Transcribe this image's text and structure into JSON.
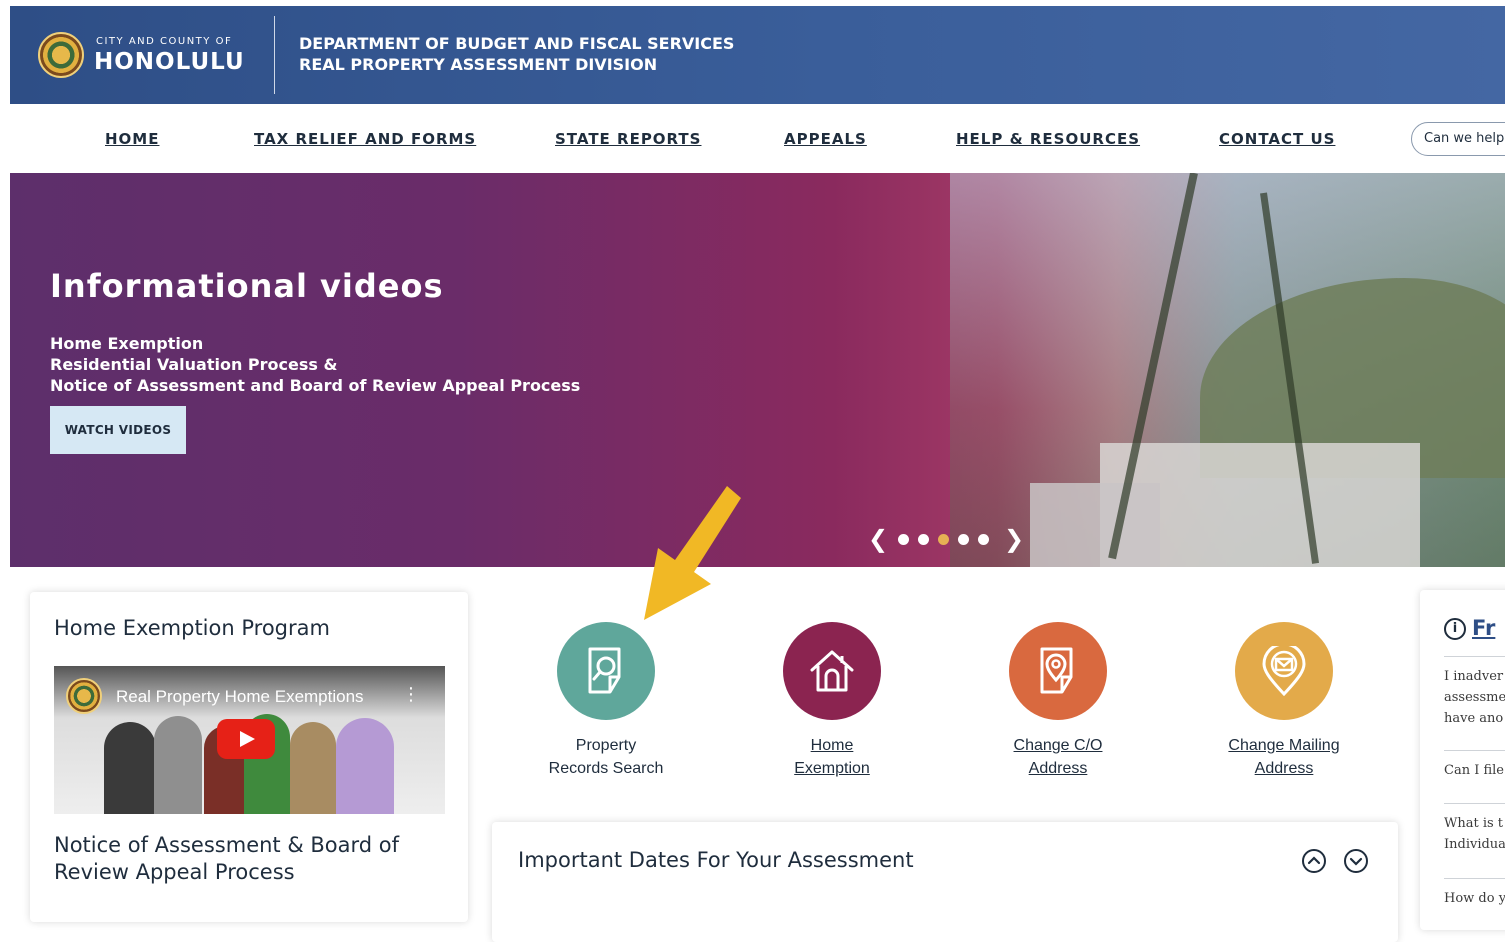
{
  "header": {
    "city_small": "CITY AND COUNTY OF",
    "city_big": "HONOLULU",
    "department": "DEPARTMENT OF BUDGET AND FISCAL SERVICES",
    "division": "REAL PROPERTY ASSESSMENT DIVISION"
  },
  "nav": {
    "items": [
      {
        "label": "HOME"
      },
      {
        "label": "TAX RELIEF AND FORMS"
      },
      {
        "label": "STATE REPORTS"
      },
      {
        "label": "APPEALS"
      },
      {
        "label": "HELP & RESOURCES"
      },
      {
        "label": "CONTACT US"
      }
    ],
    "help_placeholder": "Can we help"
  },
  "hero": {
    "title": "Informational videos",
    "lines": [
      "Home Exemption",
      "Residential Valuation Process &",
      "Notice of Assessment and Board of Review Appeal Process"
    ],
    "button_label": "WATCH VIDEOS",
    "carousel": {
      "slide_count": 5,
      "active_index": 2
    }
  },
  "home_exemption_card": {
    "title": "Home Exemption Program",
    "video_title": "Real Property Home Exemptions",
    "subtitle": "Notice of Assessment & Board of Review Appeal Process"
  },
  "quick_links": [
    {
      "line1": "Property",
      "line2": "Records Search",
      "color": "#5fa79b",
      "icon": "document-search-icon",
      "link": false
    },
    {
      "line1": "Home",
      "line2": "Exemption",
      "color": "#8b2450",
      "icon": "house-icon",
      "link": true
    },
    {
      "line1": "Change C/O",
      "line2": "Address",
      "color": "#d9693f",
      "icon": "document-location-icon",
      "link": true
    },
    {
      "line1": "Change Mailing",
      "line2": "Address",
      "color": "#e3aa4a",
      "icon": "mail-location-icon",
      "link": true
    }
  ],
  "dates_card": {
    "title": "Important Dates For Your Assessment"
  },
  "faq": {
    "title": "Fr",
    "items": [
      {
        "lines": [
          "I inadver",
          "assessme",
          "have ano"
        ]
      },
      {
        "lines": [
          "Can I file"
        ]
      },
      {
        "lines": [
          "What is t",
          "Individua"
        ]
      },
      {
        "lines": [
          "How do y"
        ]
      }
    ]
  },
  "colors": {
    "header_blue": "#2e4e86",
    "arrow_yellow": "#f1b825",
    "carousel_active": "#e6b054"
  }
}
